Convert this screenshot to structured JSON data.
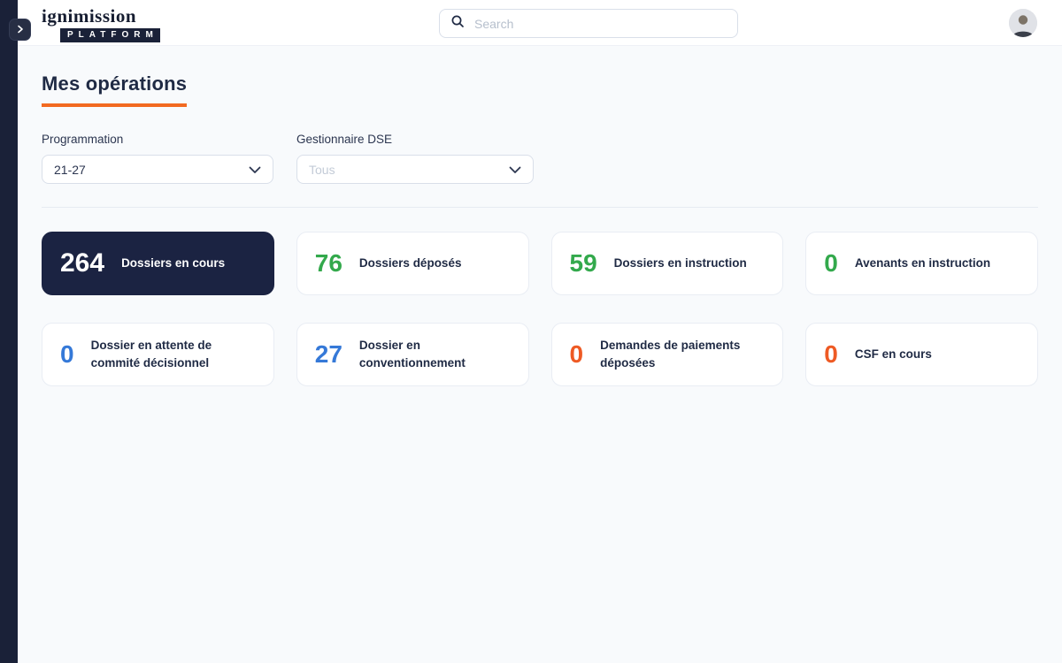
{
  "brand": {
    "name": "ignimission",
    "sub": "PLATFORM"
  },
  "header": {
    "search": {
      "placeholder": "Search"
    }
  },
  "page": {
    "title": "Mes opérations"
  },
  "filters": {
    "programmation": {
      "label": "Programmation",
      "value": "21-27"
    },
    "gestionnaire": {
      "label": "Gestionnaire DSE",
      "placeholder_value": "Tous"
    }
  },
  "stats": [
    {
      "value": "264",
      "label": "Dossiers en cours",
      "variant": "dark"
    },
    {
      "value": "76",
      "label": "Dossiers déposés",
      "variant": "green"
    },
    {
      "value": "59",
      "label": "Dossiers en instruction",
      "variant": "green"
    },
    {
      "value": "0",
      "label": "Avenants en instruction",
      "variant": "green"
    },
    {
      "value": "0",
      "label": "Dossier en attente de commité décisionnel",
      "variant": "blue"
    },
    {
      "value": "27",
      "label": "Dossier en conventionnement",
      "variant": "blue"
    },
    {
      "value": "0",
      "label": "Demandes de paiements déposées",
      "variant": "orange"
    },
    {
      "value": "0",
      "label": "CSF en cours",
      "variant": "orange"
    }
  ],
  "colors": {
    "accent_orange": "#F26A21",
    "stat_green": "#33A94C",
    "stat_blue": "#3579D8",
    "stat_orange": "#EE5A24",
    "dark_navy": "#1B2342",
    "strip_navy": "#1A2138"
  }
}
